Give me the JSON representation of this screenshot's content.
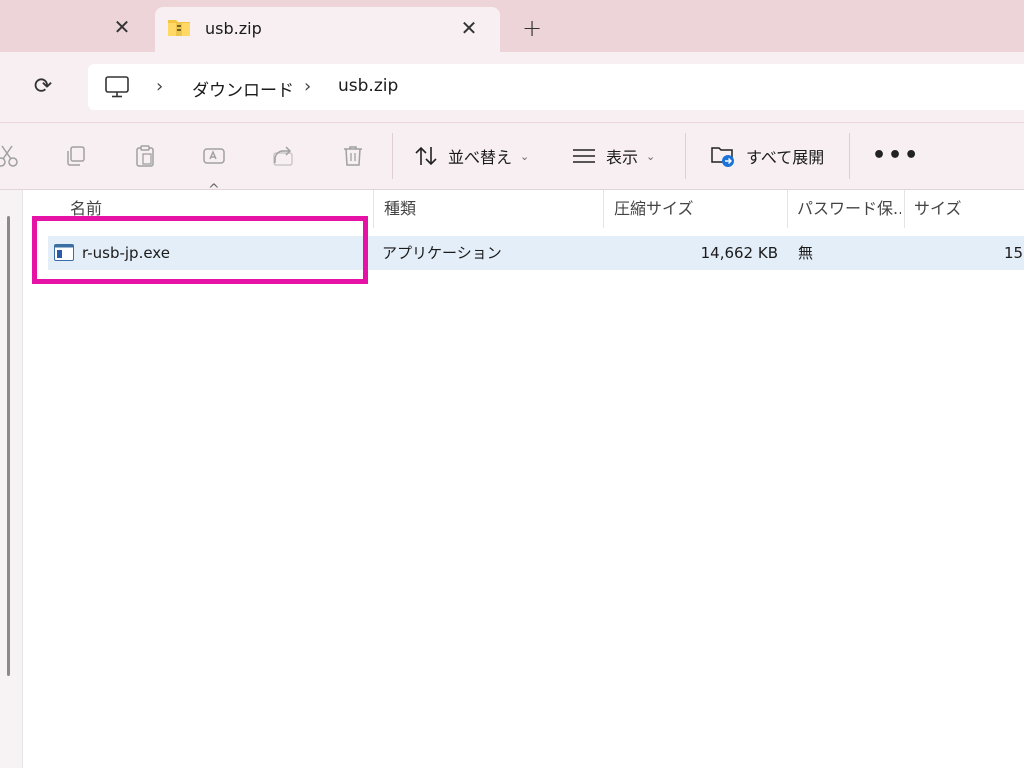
{
  "tabs": {
    "active_title": "usb.zip",
    "close_glyph": "✕",
    "new_glyph": "+"
  },
  "address": {
    "crumbs": [
      "ダウンロード",
      "usb.zip"
    ],
    "separator": "›"
  },
  "toolbar": {
    "sort_label": "並べ替え",
    "view_label": "表示",
    "extract_label": "すべて展開",
    "more_glyph": "•••",
    "chevron": "⌄"
  },
  "columns": {
    "name": "名前",
    "type": "種類",
    "compressed_size": "圧縮サイズ",
    "password": "パスワード保...",
    "size": "サイズ"
  },
  "files": [
    {
      "name": "r-usb-jp.exe",
      "type": "アプリケーション",
      "compressed_size": "14,662 KB",
      "password": "無",
      "size": "15,"
    }
  ],
  "colors": {
    "tabbar_bg": "#ecd4d9",
    "chrome_bg": "#f7eff1",
    "selection_bg": "#e4eef8",
    "highlight_border": "#e612a6"
  }
}
